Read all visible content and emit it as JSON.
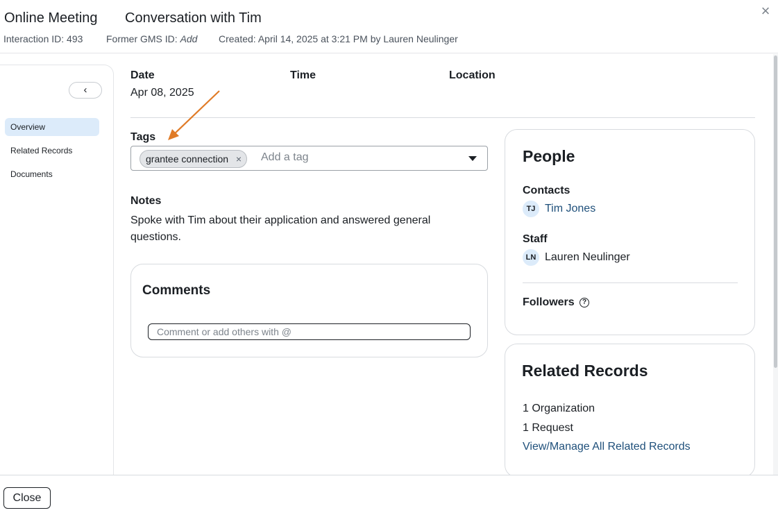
{
  "header": {
    "type": "Online Meeting",
    "title": "Conversation with Tim",
    "interaction_id": "Interaction ID: 493",
    "former_gms_label": "Former GMS ID:",
    "former_gms_value": "Add",
    "created": "Created: April 14, 2025 at 3:21 PM by Lauren Neulinger",
    "close_icon": "×"
  },
  "sidebar": {
    "collapse_icon": "‹",
    "items": [
      {
        "label": "Overview",
        "active": true
      },
      {
        "label": "Related Records",
        "active": false
      },
      {
        "label": "Documents",
        "active": false
      }
    ]
  },
  "details": {
    "date_label": "Date",
    "date_value": "Apr 08, 2025",
    "time_label": "Time",
    "location_label": "Location"
  },
  "tags": {
    "label": "Tags",
    "chips": [
      "grantee connection"
    ],
    "chip_remove_icon": "×",
    "placeholder": "Add a tag"
  },
  "notes": {
    "label": "Notes",
    "text": "Spoke with Tim about their application and answered general questions."
  },
  "comments": {
    "title": "Comments",
    "placeholder": "Comment or add others with @"
  },
  "people": {
    "title": "People",
    "contacts_label": "Contacts",
    "contacts": [
      {
        "initials": "TJ",
        "name": "Tim Jones"
      }
    ],
    "staff_label": "Staff",
    "staff": [
      {
        "initials": "LN",
        "name": "Lauren Neulinger"
      }
    ],
    "followers_label": "Followers",
    "help_icon": "?"
  },
  "related_records": {
    "title": "Related Records",
    "organizations": "1 Organization",
    "requests": "1 Request",
    "manage_link": "View/Manage All Related Records"
  },
  "footer": {
    "close_label": "Close"
  },
  "colors": {
    "accent_link": "#1e4f7a",
    "active_nav": "#dcebfa",
    "annotation_arrow": "#e07b27"
  }
}
